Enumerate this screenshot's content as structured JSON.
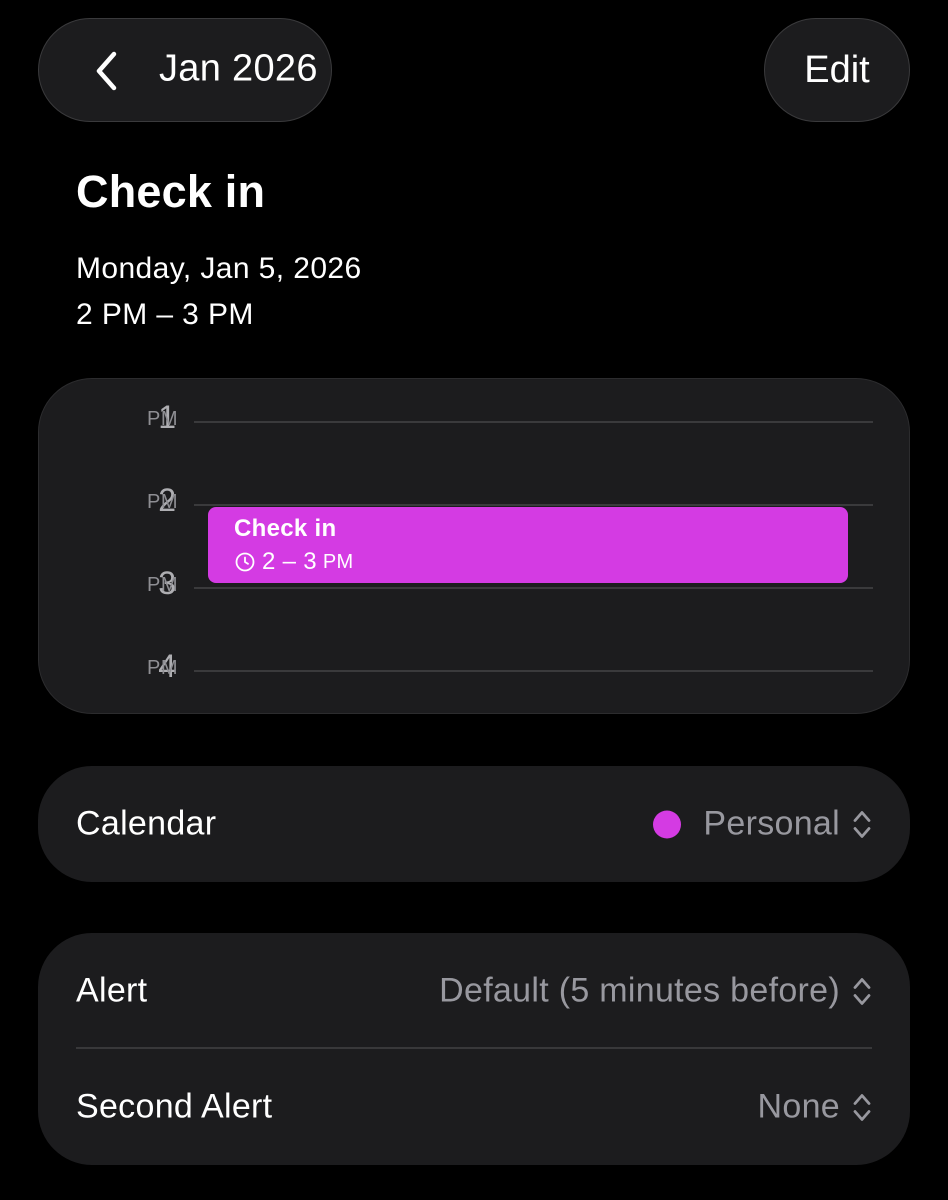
{
  "header": {
    "back_label": "Jan 2026",
    "edit_label": "Edit",
    "back_icon": "chevron-left-icon"
  },
  "event": {
    "title": "Check in",
    "date": "Monday, Jan 5, 2026",
    "time": "2 PM – 3 PM",
    "color": "#d43be3"
  },
  "timeline": {
    "hours": [
      {
        "num": "1",
        "suffix": "PM"
      },
      {
        "num": "2",
        "suffix": "PM"
      },
      {
        "num": "3",
        "suffix": "PM"
      },
      {
        "num": "4",
        "suffix": "PM"
      }
    ],
    "block": {
      "title": "Check in",
      "time": "2 – 3",
      "ampm": "PM",
      "icon": "clock-icon"
    }
  },
  "calendar_row": {
    "label": "Calendar",
    "value": "Personal",
    "icon": "chevron-up-down-icon"
  },
  "alerts": [
    {
      "label": "Alert",
      "value": "Default (5 minutes before)"
    },
    {
      "label": "Second Alert",
      "value": "None"
    }
  ],
  "colors": {
    "background": "#000000",
    "card": "#1c1c1e",
    "accent": "#d43be3",
    "secondary_text": "#98989f"
  }
}
